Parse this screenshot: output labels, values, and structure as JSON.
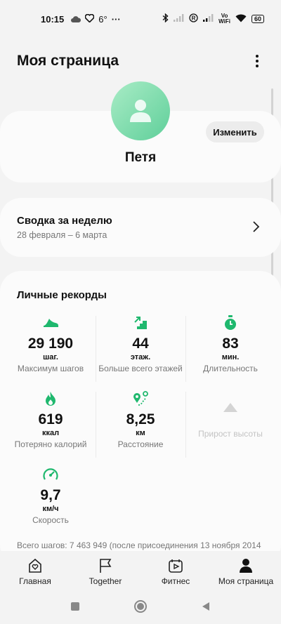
{
  "status_bar": {
    "time": "10:15",
    "temperature": "6°",
    "more": "···",
    "wifi_label_top": "Vo",
    "wifi_label_bottom": "WiFi",
    "battery": "60"
  },
  "header": {
    "title": "Моя страница"
  },
  "profile": {
    "name": "Петя",
    "edit_label": "Изменить",
    "avatar_color": "#6fd6a2"
  },
  "weekly_summary": {
    "title": "Сводка за неделю",
    "dates": "28 февраля – 6 марта"
  },
  "records": {
    "title": "Личные рекорды",
    "accent_color": "#1fb86e",
    "items": [
      {
        "icon": "shoe-icon",
        "value": "29 190",
        "unit": "шаг.",
        "label": "Максимум шагов"
      },
      {
        "icon": "stairs-icon",
        "value": "44",
        "unit": "этаж.",
        "label": "Больше всего этажей"
      },
      {
        "icon": "stopwatch-icon",
        "value": "83",
        "unit": "мин.",
        "label": "Длительность"
      },
      {
        "icon": "flame-icon",
        "value": "619",
        "unit": "ккал",
        "label": "Потеряно калорий"
      },
      {
        "icon": "route-icon",
        "value": "8,25",
        "unit": "км",
        "label": "Расстояние"
      },
      {
        "icon": "mountain-icon",
        "value": "",
        "unit": "",
        "label": "Прирост высоты"
      },
      {
        "icon": "speedometer-icon",
        "value": "9,7",
        "unit": "км/ч",
        "label": "Скорость"
      }
    ],
    "total_steps": "Всего шагов: 7 463 949 (после присоединения 13 ноября 2014"
  },
  "bottom_nav": [
    {
      "icon": "heart-home-icon",
      "label": "Главная"
    },
    {
      "icon": "flag-icon",
      "label": "Together"
    },
    {
      "icon": "fitness-icon",
      "label": "Фитнес"
    },
    {
      "icon": "person-icon",
      "label": "Моя страница"
    }
  ]
}
